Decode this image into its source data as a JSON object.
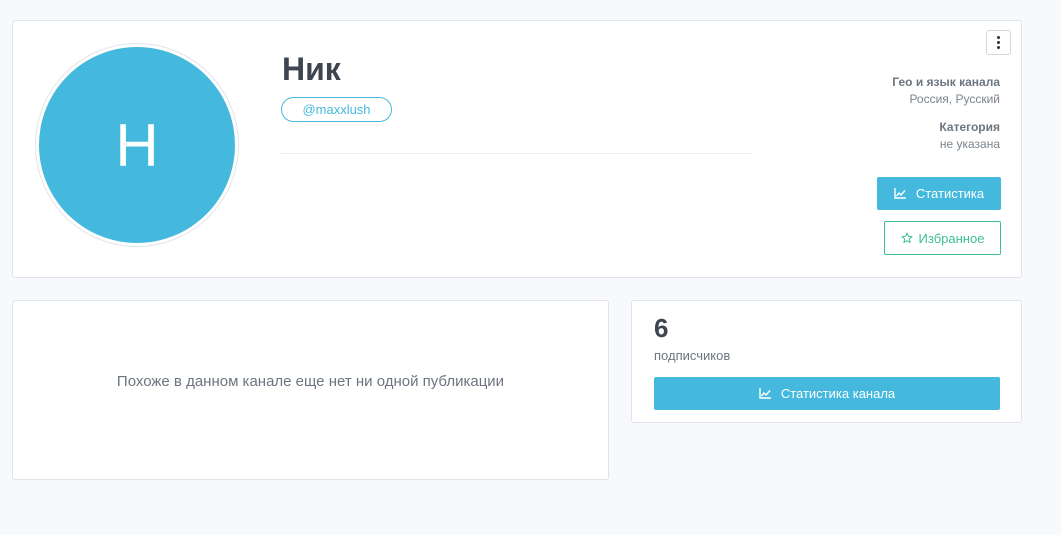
{
  "profile": {
    "avatar_letter": "Н",
    "name": "Ник",
    "username": "@maxxlush",
    "geo_label": "Гео и язык канала",
    "geo_value": "Россия, Русский",
    "category_label": "Категория",
    "category_value": "не указана",
    "stats_button_label": "Статистика",
    "favorite_button_label": "Избранное",
    "avatar_color": "#45b9dd"
  },
  "posts": {
    "empty_message": "Похоже в данном канале еще нет ни одной публикации"
  },
  "subscribers": {
    "count": "6",
    "label": "подписчиков",
    "stats_button_label": "Статистика канала"
  },
  "icons": {
    "menu": "kebab-menu-icon",
    "stats": "line-chart-icon",
    "favorite": "star-icon"
  },
  "colors": {
    "accent": "#45b9dd",
    "favorite": "#3ebe96"
  }
}
